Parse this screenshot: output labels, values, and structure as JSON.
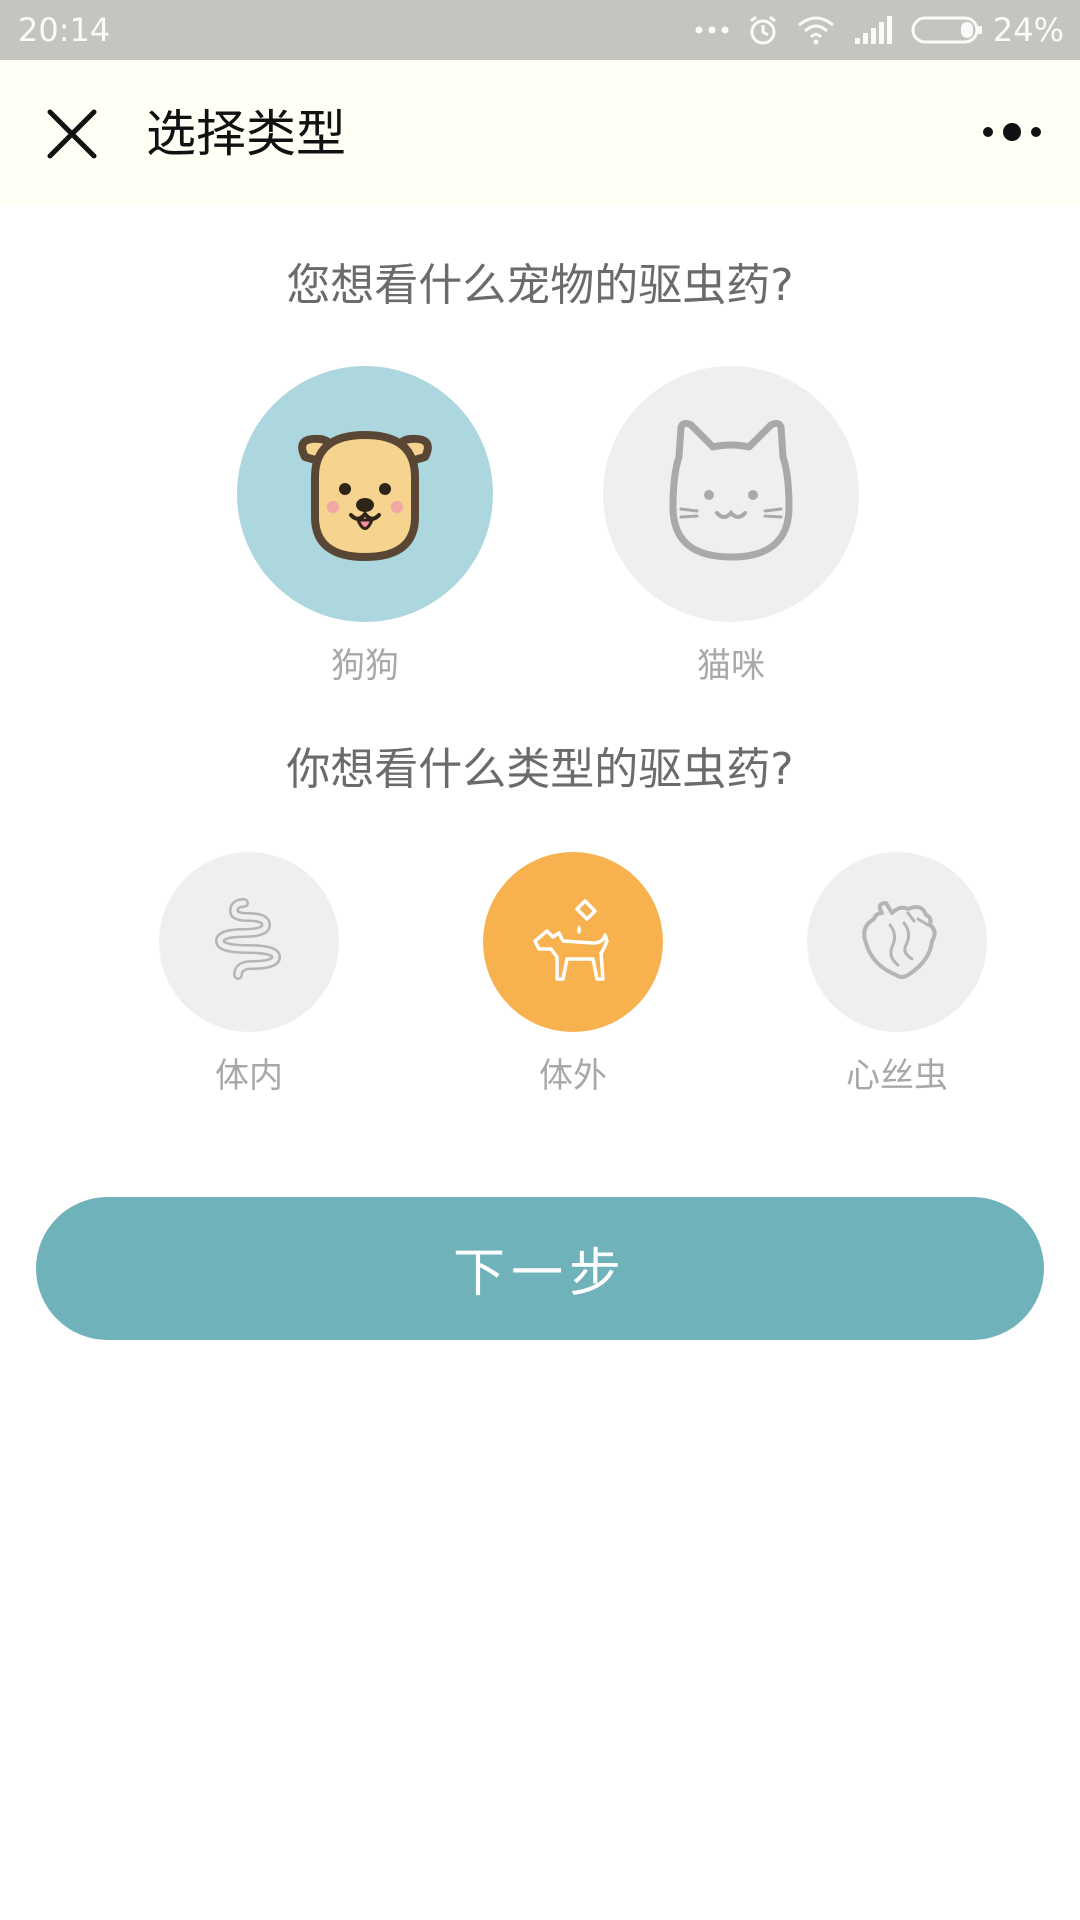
{
  "status_bar": {
    "time": "20:14",
    "battery_percent_text": "24%",
    "icons": [
      "more-dots-icon",
      "alarm-icon",
      "wifi-icon",
      "signal-icon",
      "battery-icon"
    ]
  },
  "header": {
    "title": "选择类型",
    "close_icon": "close-icon",
    "more_icon": "more-icon"
  },
  "pet_section": {
    "question": "您想看什么宠物的驱虫药?",
    "options": [
      {
        "label": "狗狗",
        "icon": "dog-icon",
        "selected": true
      },
      {
        "label": "猫咪",
        "icon": "cat-icon",
        "selected": false
      }
    ]
  },
  "type_section": {
    "question": "你想看什么类型的驱虫药?",
    "options": [
      {
        "label": "体内",
        "icon": "intestine-icon",
        "selected": false
      },
      {
        "label": "体外",
        "icon": "dog-drop-icon",
        "selected": true
      },
      {
        "label": "心丝虫",
        "icon": "heart-icon",
        "selected": false
      }
    ]
  },
  "next_button": {
    "label": "下一步"
  },
  "colors": {
    "status_bar_bg": "#c5c4bf",
    "nav_bg": "#fffff6",
    "pet_selected_bg": "#acd7de",
    "type_selected_bg": "#f7b24f",
    "unselected_bg": "#efefef",
    "button_bg": "#70b2ba"
  }
}
